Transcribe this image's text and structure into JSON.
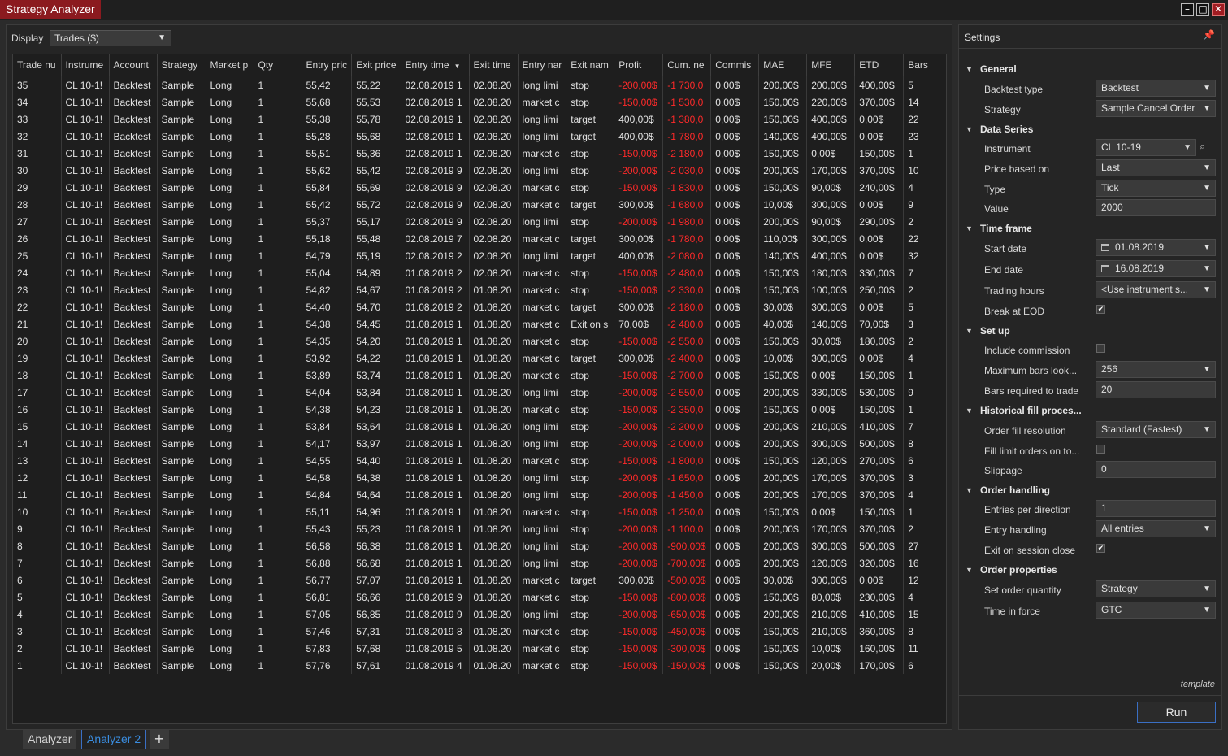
{
  "window": {
    "title": "Strategy Analyzer",
    "controls": [
      "minimize-icon",
      "maximize-icon",
      "close-icon"
    ]
  },
  "display": {
    "label": "Display",
    "value": "Trades ($)"
  },
  "colors": {
    "negative": "#ff2a2a",
    "accent": "#3a8de0",
    "title_bg": "#8b1a1f"
  },
  "table": {
    "columns": [
      "Trade nu",
      "Instrume",
      "Account",
      "Strategy",
      "Market p",
      "Qty",
      "Entry pric",
      "Exit price",
      "Entry time",
      "Exit time",
      "Entry nar",
      "Exit nam",
      "Profit",
      "Cum. ne",
      "Commis",
      "MAE",
      "MFE",
      "ETD",
      "Bars"
    ],
    "sorted_column": "Entry time",
    "rows": [
      [
        "35",
        "CL 10-1!",
        "Backtest",
        "Sample",
        "Long",
        "1",
        "55,42",
        "55,22",
        "02.08.2019 1",
        "02.08.20",
        "long limi",
        "stop",
        "-200,00$",
        "-1 730,0",
        "0,00$",
        "200,00$",
        "200,00$",
        "400,00$",
        "5"
      ],
      [
        "34",
        "CL 10-1!",
        "Backtest",
        "Sample",
        "Long",
        "1",
        "55,68",
        "55,53",
        "02.08.2019 1",
        "02.08.20",
        "market c",
        "stop",
        "-150,00$",
        "-1 530,0",
        "0,00$",
        "150,00$",
        "220,00$",
        "370,00$",
        "14"
      ],
      [
        "33",
        "CL 10-1!",
        "Backtest",
        "Sample",
        "Long",
        "1",
        "55,38",
        "55,78",
        "02.08.2019 1",
        "02.08.20",
        "long limi",
        "target",
        "400,00$",
        "-1 380,0",
        "0,00$",
        "150,00$",
        "400,00$",
        "0,00$",
        "22"
      ],
      [
        "32",
        "CL 10-1!",
        "Backtest",
        "Sample",
        "Long",
        "1",
        "55,28",
        "55,68",
        "02.08.2019 1",
        "02.08.20",
        "long limi",
        "target",
        "400,00$",
        "-1 780,0",
        "0,00$",
        "140,00$",
        "400,00$",
        "0,00$",
        "23"
      ],
      [
        "31",
        "CL 10-1!",
        "Backtest",
        "Sample",
        "Long",
        "1",
        "55,51",
        "55,36",
        "02.08.2019 1",
        "02.08.20",
        "market c",
        "stop",
        "-150,00$",
        "-2 180,0",
        "0,00$",
        "150,00$",
        "0,00$",
        "150,00$",
        "1"
      ],
      [
        "30",
        "CL 10-1!",
        "Backtest",
        "Sample",
        "Long",
        "1",
        "55,62",
        "55,42",
        "02.08.2019 9",
        "02.08.20",
        "long limi",
        "stop",
        "-200,00$",
        "-2 030,0",
        "0,00$",
        "200,00$",
        "170,00$",
        "370,00$",
        "10"
      ],
      [
        "29",
        "CL 10-1!",
        "Backtest",
        "Sample",
        "Long",
        "1",
        "55,84",
        "55,69",
        "02.08.2019 9",
        "02.08.20",
        "market c",
        "stop",
        "-150,00$",
        "-1 830,0",
        "0,00$",
        "150,00$",
        "90,00$",
        "240,00$",
        "4"
      ],
      [
        "28",
        "CL 10-1!",
        "Backtest",
        "Sample",
        "Long",
        "1",
        "55,42",
        "55,72",
        "02.08.2019 9",
        "02.08.20",
        "market c",
        "target",
        "300,00$",
        "-1 680,0",
        "0,00$",
        "10,00$",
        "300,00$",
        "0,00$",
        "9"
      ],
      [
        "27",
        "CL 10-1!",
        "Backtest",
        "Sample",
        "Long",
        "1",
        "55,37",
        "55,17",
        "02.08.2019 9",
        "02.08.20",
        "long limi",
        "stop",
        "-200,00$",
        "-1 980,0",
        "0,00$",
        "200,00$",
        "90,00$",
        "290,00$",
        "2"
      ],
      [
        "26",
        "CL 10-1!",
        "Backtest",
        "Sample",
        "Long",
        "1",
        "55,18",
        "55,48",
        "02.08.2019 7",
        "02.08.20",
        "market c",
        "target",
        "300,00$",
        "-1 780,0",
        "0,00$",
        "110,00$",
        "300,00$",
        "0,00$",
        "22"
      ],
      [
        "25",
        "CL 10-1!",
        "Backtest",
        "Sample",
        "Long",
        "1",
        "54,79",
        "55,19",
        "02.08.2019 2",
        "02.08.20",
        "long limi",
        "target",
        "400,00$",
        "-2 080,0",
        "0,00$",
        "140,00$",
        "400,00$",
        "0,00$",
        "32"
      ],
      [
        "24",
        "CL 10-1!",
        "Backtest",
        "Sample",
        "Long",
        "1",
        "55,04",
        "54,89",
        "01.08.2019 2",
        "02.08.20",
        "market c",
        "stop",
        "-150,00$",
        "-2 480,0",
        "0,00$",
        "150,00$",
        "180,00$",
        "330,00$",
        "7"
      ],
      [
        "23",
        "CL 10-1!",
        "Backtest",
        "Sample",
        "Long",
        "1",
        "54,82",
        "54,67",
        "01.08.2019 2",
        "01.08.20",
        "market c",
        "stop",
        "-150,00$",
        "-2 330,0",
        "0,00$",
        "150,00$",
        "100,00$",
        "250,00$",
        "2"
      ],
      [
        "22",
        "CL 10-1!",
        "Backtest",
        "Sample",
        "Long",
        "1",
        "54,40",
        "54,70",
        "01.08.2019 2",
        "01.08.20",
        "market c",
        "target",
        "300,00$",
        "-2 180,0",
        "0,00$",
        "30,00$",
        "300,00$",
        "0,00$",
        "5"
      ],
      [
        "21",
        "CL 10-1!",
        "Backtest",
        "Sample",
        "Long",
        "1",
        "54,38",
        "54,45",
        "01.08.2019 1",
        "01.08.20",
        "market c",
        "Exit on s",
        "70,00$",
        "-2 480,0",
        "0,00$",
        "40,00$",
        "140,00$",
        "70,00$",
        "3"
      ],
      [
        "20",
        "CL 10-1!",
        "Backtest",
        "Sample",
        "Long",
        "1",
        "54,35",
        "54,20",
        "01.08.2019 1",
        "01.08.20",
        "market c",
        "stop",
        "-150,00$",
        "-2 550,0",
        "0,00$",
        "150,00$",
        "30,00$",
        "180,00$",
        "2"
      ],
      [
        "19",
        "CL 10-1!",
        "Backtest",
        "Sample",
        "Long",
        "1",
        "53,92",
        "54,22",
        "01.08.2019 1",
        "01.08.20",
        "market c",
        "target",
        "300,00$",
        "-2 400,0",
        "0,00$",
        "10,00$",
        "300,00$",
        "0,00$",
        "4"
      ],
      [
        "18",
        "CL 10-1!",
        "Backtest",
        "Sample",
        "Long",
        "1",
        "53,89",
        "53,74",
        "01.08.2019 1",
        "01.08.20",
        "market c",
        "stop",
        "-150,00$",
        "-2 700,0",
        "0,00$",
        "150,00$",
        "0,00$",
        "150,00$",
        "1"
      ],
      [
        "17",
        "CL 10-1!",
        "Backtest",
        "Sample",
        "Long",
        "1",
        "54,04",
        "53,84",
        "01.08.2019 1",
        "01.08.20",
        "long limi",
        "stop",
        "-200,00$",
        "-2 550,0",
        "0,00$",
        "200,00$",
        "330,00$",
        "530,00$",
        "9"
      ],
      [
        "16",
        "CL 10-1!",
        "Backtest",
        "Sample",
        "Long",
        "1",
        "54,38",
        "54,23",
        "01.08.2019 1",
        "01.08.20",
        "market c",
        "stop",
        "-150,00$",
        "-2 350,0",
        "0,00$",
        "150,00$",
        "0,00$",
        "150,00$",
        "1"
      ],
      [
        "15",
        "CL 10-1!",
        "Backtest",
        "Sample",
        "Long",
        "1",
        "53,84",
        "53,64",
        "01.08.2019 1",
        "01.08.20",
        "long limi",
        "stop",
        "-200,00$",
        "-2 200,0",
        "0,00$",
        "200,00$",
        "210,00$",
        "410,00$",
        "7"
      ],
      [
        "14",
        "CL 10-1!",
        "Backtest",
        "Sample",
        "Long",
        "1",
        "54,17",
        "53,97",
        "01.08.2019 1",
        "01.08.20",
        "long limi",
        "stop",
        "-200,00$",
        "-2 000,0",
        "0,00$",
        "200,00$",
        "300,00$",
        "500,00$",
        "8"
      ],
      [
        "13",
        "CL 10-1!",
        "Backtest",
        "Sample",
        "Long",
        "1",
        "54,55",
        "54,40",
        "01.08.2019 1",
        "01.08.20",
        "market c",
        "stop",
        "-150,00$",
        "-1 800,0",
        "0,00$",
        "150,00$",
        "120,00$",
        "270,00$",
        "6"
      ],
      [
        "12",
        "CL 10-1!",
        "Backtest",
        "Sample",
        "Long",
        "1",
        "54,58",
        "54,38",
        "01.08.2019 1",
        "01.08.20",
        "long limi",
        "stop",
        "-200,00$",
        "-1 650,0",
        "0,00$",
        "200,00$",
        "170,00$",
        "370,00$",
        "3"
      ],
      [
        "11",
        "CL 10-1!",
        "Backtest",
        "Sample",
        "Long",
        "1",
        "54,84",
        "54,64",
        "01.08.2019 1",
        "01.08.20",
        "long limi",
        "stop",
        "-200,00$",
        "-1 450,0",
        "0,00$",
        "200,00$",
        "170,00$",
        "370,00$",
        "4"
      ],
      [
        "10",
        "CL 10-1!",
        "Backtest",
        "Sample",
        "Long",
        "1",
        "55,11",
        "54,96",
        "01.08.2019 1",
        "01.08.20",
        "market c",
        "stop",
        "-150,00$",
        "-1 250,0",
        "0,00$",
        "150,00$",
        "0,00$",
        "150,00$",
        "1"
      ],
      [
        "9",
        "CL 10-1!",
        "Backtest",
        "Sample",
        "Long",
        "1",
        "55,43",
        "55,23",
        "01.08.2019 1",
        "01.08.20",
        "long limi",
        "stop",
        "-200,00$",
        "-1 100,0",
        "0,00$",
        "200,00$",
        "170,00$",
        "370,00$",
        "2"
      ],
      [
        "8",
        "CL 10-1!",
        "Backtest",
        "Sample",
        "Long",
        "1",
        "56,58",
        "56,38",
        "01.08.2019 1",
        "01.08.20",
        "long limi",
        "stop",
        "-200,00$",
        "-900,00$",
        "0,00$",
        "200,00$",
        "300,00$",
        "500,00$",
        "27"
      ],
      [
        "7",
        "CL 10-1!",
        "Backtest",
        "Sample",
        "Long",
        "1",
        "56,88",
        "56,68",
        "01.08.2019 1",
        "01.08.20",
        "long limi",
        "stop",
        "-200,00$",
        "-700,00$",
        "0,00$",
        "200,00$",
        "120,00$",
        "320,00$",
        "16"
      ],
      [
        "6",
        "CL 10-1!",
        "Backtest",
        "Sample",
        "Long",
        "1",
        "56,77",
        "57,07",
        "01.08.2019 1",
        "01.08.20",
        "market c",
        "target",
        "300,00$",
        "-500,00$",
        "0,00$",
        "30,00$",
        "300,00$",
        "0,00$",
        "12"
      ],
      [
        "5",
        "CL 10-1!",
        "Backtest",
        "Sample",
        "Long",
        "1",
        "56,81",
        "56,66",
        "01.08.2019 9",
        "01.08.20",
        "market c",
        "stop",
        "-150,00$",
        "-800,00$",
        "0,00$",
        "150,00$",
        "80,00$",
        "230,00$",
        "4"
      ],
      [
        "4",
        "CL 10-1!",
        "Backtest",
        "Sample",
        "Long",
        "1",
        "57,05",
        "56,85",
        "01.08.2019 9",
        "01.08.20",
        "long limi",
        "stop",
        "-200,00$",
        "-650,00$",
        "0,00$",
        "200,00$",
        "210,00$",
        "410,00$",
        "15"
      ],
      [
        "3",
        "CL 10-1!",
        "Backtest",
        "Sample",
        "Long",
        "1",
        "57,46",
        "57,31",
        "01.08.2019 8",
        "01.08.20",
        "market c",
        "stop",
        "-150,00$",
        "-450,00$",
        "0,00$",
        "150,00$",
        "210,00$",
        "360,00$",
        "8"
      ],
      [
        "2",
        "CL 10-1!",
        "Backtest",
        "Sample",
        "Long",
        "1",
        "57,83",
        "57,68",
        "01.08.2019 5",
        "01.08.20",
        "market c",
        "stop",
        "-150,00$",
        "-300,00$",
        "0,00$",
        "150,00$",
        "10,00$",
        "160,00$",
        "11"
      ],
      [
        "1",
        "CL 10-1!",
        "Backtest",
        "Sample",
        "Long",
        "1",
        "57,76",
        "57,61",
        "01.08.2019 4",
        "01.08.20",
        "market c",
        "stop",
        "-150,00$",
        "-150,00$",
        "0,00$",
        "150,00$",
        "20,00$",
        "170,00$",
        "6"
      ]
    ]
  },
  "settings": {
    "title": "Settings",
    "template_link": "template",
    "run_label": "Run",
    "rows": [
      {
        "type": "category",
        "label": "General"
      },
      {
        "type": "select",
        "label": "Backtest type",
        "value": "Backtest"
      },
      {
        "type": "select",
        "label": "Strategy",
        "value": "Sample Cancel Order"
      },
      {
        "type": "category",
        "label": "Data Series"
      },
      {
        "type": "instrument",
        "label": "Instrument",
        "value": "CL 10-19"
      },
      {
        "type": "select",
        "label": "Price based on",
        "value": "Last"
      },
      {
        "type": "select",
        "label": "Type",
        "value": "Tick"
      },
      {
        "type": "text",
        "label": "Value",
        "value": "2000"
      },
      {
        "type": "category",
        "label": "Time frame"
      },
      {
        "type": "date",
        "label": "Start date",
        "value": "01.08.2019"
      },
      {
        "type": "date",
        "label": "End date",
        "value": "16.08.2019"
      },
      {
        "type": "select",
        "label": "Trading hours",
        "value": "<Use instrument s..."
      },
      {
        "type": "checkbox",
        "label": "Break at EOD",
        "checked": true
      },
      {
        "type": "category",
        "label": "Set up"
      },
      {
        "type": "checkbox",
        "label": "Include commission",
        "checked": false
      },
      {
        "type": "select",
        "label": "Maximum bars look...",
        "value": "256"
      },
      {
        "type": "text",
        "label": "Bars required to trade",
        "value": "20"
      },
      {
        "type": "category",
        "label": "Historical fill proces..."
      },
      {
        "type": "select",
        "label": "Order fill resolution",
        "value": "Standard (Fastest)"
      },
      {
        "type": "checkbox",
        "label": "Fill limit orders on to...",
        "checked": false
      },
      {
        "type": "text",
        "label": "Slippage",
        "value": "0"
      },
      {
        "type": "category",
        "label": "Order handling"
      },
      {
        "type": "text",
        "label": "Entries per direction",
        "value": "1"
      },
      {
        "type": "select",
        "label": "Entry handling",
        "value": "All entries"
      },
      {
        "type": "checkbox",
        "label": "Exit on session close",
        "checked": true
      },
      {
        "type": "category",
        "label": "Order properties"
      },
      {
        "type": "select",
        "label": "Set order quantity",
        "value": "Strategy"
      },
      {
        "type": "select",
        "label": "Time in force",
        "value": "GTC"
      }
    ]
  },
  "tabs": [
    {
      "label": "Analyzer",
      "active": false
    },
    {
      "label": "Analyzer 2",
      "active": true
    }
  ],
  "add_tab_label": "+"
}
